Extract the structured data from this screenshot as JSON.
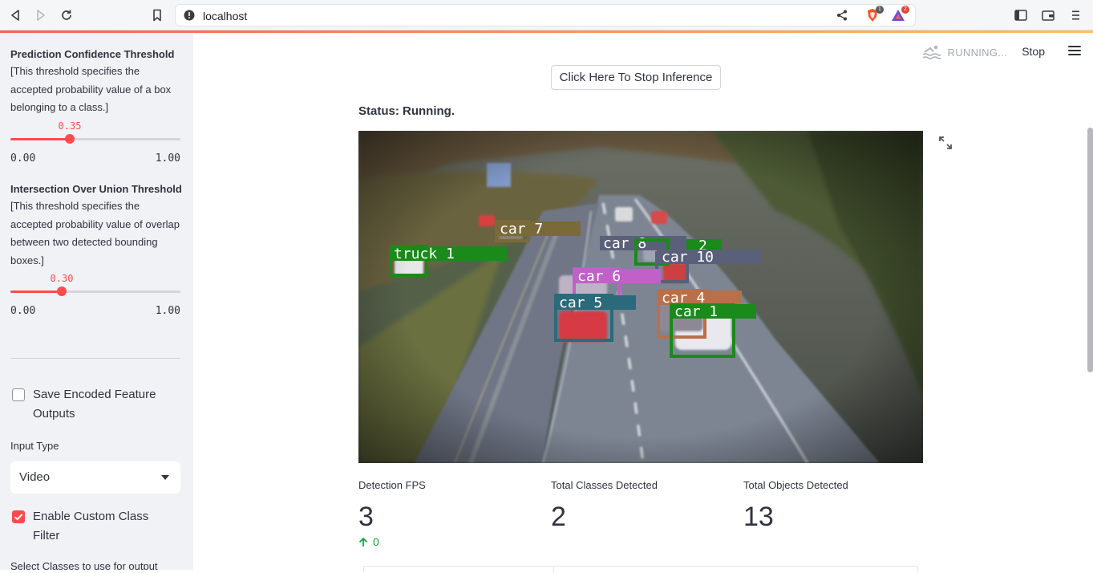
{
  "browser": {
    "url": "localhost",
    "brave_badge": "1",
    "rewards_badge": "2"
  },
  "sidebar": {
    "confidence": {
      "title": "Prediction Confidence Threshold",
      "description": "[This threshold specifies the accepted probability value of a box belonging to a class.]",
      "value": "0.35",
      "value_fraction": 0.35,
      "min": "0.00",
      "max": "1.00"
    },
    "iou": {
      "title": "Intersection Over Union Threshold",
      "description": "[This threshold specifies the accepted probability value of overlap between two detected bounding boxes.]",
      "value": "0.30",
      "value_fraction": 0.3,
      "min": "0.00",
      "max": "1.00"
    },
    "save_encoded": {
      "label": "Save Encoded Feature Outputs",
      "checked": false
    },
    "input_type": {
      "label": "Input Type",
      "value": "Video"
    },
    "custom_filter": {
      "label": "Enable Custom Class Filter",
      "checked": true
    },
    "select_classes_label": "Select Classes to use for output"
  },
  "header": {
    "running": "RUNNING...",
    "stop": "Stop"
  },
  "main": {
    "stop_button": "Click Here To Stop Inference",
    "status": "Status: Running.",
    "detections": [
      {
        "label": "truck 1",
        "color": "#1a8a1a"
      },
      {
        "label": "car 7",
        "color": "#7a6a3a"
      },
      {
        "label": "car 8",
        "color": "#5a5f7a"
      },
      {
        "label": "2",
        "color": "#1a8a1a"
      },
      {
        "label": "car 10",
        "color": "#5a5f7a"
      },
      {
        "label": "car 6",
        "color": "#c060c8"
      },
      {
        "label": "car 5",
        "color": "#2a6a7a"
      },
      {
        "label": "car 4",
        "color": "#b8704a"
      },
      {
        "label": "car 1",
        "color": "#1a8a1a"
      }
    ],
    "metrics": [
      {
        "label": "Detection FPS",
        "value": "3"
      },
      {
        "label": "Total Classes Detected",
        "value": "2"
      },
      {
        "label": "Total Objects Detected",
        "value": "13"
      }
    ],
    "fps_delta": "0"
  },
  "colors": {
    "accent": "#ff4b4b",
    "sidebar_bg": "#f0f2f6",
    "delta_green": "#09ab3b"
  }
}
